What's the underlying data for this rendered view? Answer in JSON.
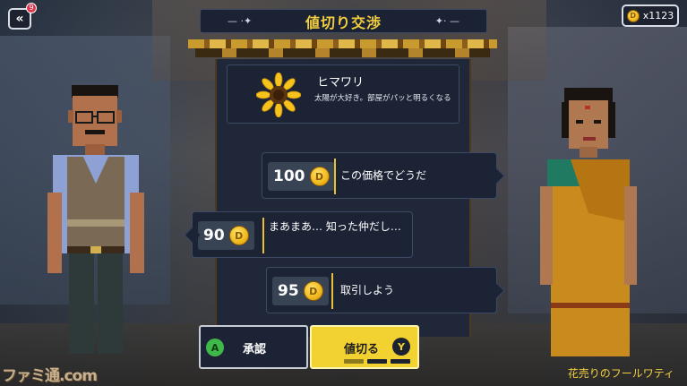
{
  "header": {
    "title": "値切り交渉",
    "back_badge": "9",
    "back_icon": "chevron-double-left-icon"
  },
  "wallet": {
    "coins": "x1123",
    "coin_glyph": "D"
  },
  "item": {
    "name": "ヒマワリ",
    "description": "太陽が大好き。部屋がパッと明るくなる",
    "icon": "sunflower-icon"
  },
  "offers": [
    {
      "speaker": "npc",
      "price": "100",
      "text": "この価格でどうだ"
    },
    {
      "speaker": "player",
      "price": "90",
      "text": "まあまあ… 知った仲だし…"
    },
    {
      "speaker": "npc",
      "price": "95",
      "text": "取引しよう"
    }
  ],
  "actions": {
    "accept_label": "承認",
    "accept_key": "A",
    "negotiate_label": "値切る",
    "negotiate_key": "Y",
    "negotiate_attempts_total": 3,
    "negotiate_attempts_used": 1
  },
  "npc": {
    "name": "花売りのフールワティ"
  },
  "watermark": "ファミ通.com",
  "colors": {
    "accent_gold": "#f3cf3f",
    "panel": "#1b2335",
    "button_active": "#f2d230"
  }
}
